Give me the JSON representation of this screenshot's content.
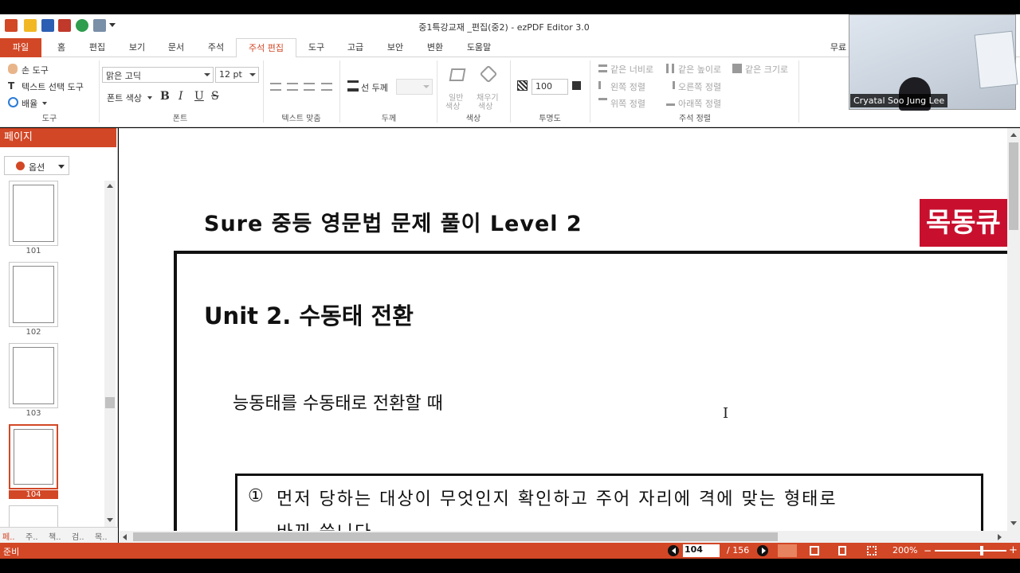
{
  "window": {
    "title": "중1특강교재 _편집(중2) - ezPDF Editor 3.0"
  },
  "tabs": [
    "파일",
    "홈",
    "편집",
    "보기",
    "문서",
    "주석",
    "주석 편집",
    "도구",
    "고급",
    "보안",
    "변환",
    "도움말"
  ],
  "ribbon": {
    "tools": {
      "hand": "손 도구",
      "text_select": "텍스트 선택 도구",
      "zoom": "배율",
      "label": "도구"
    },
    "font": {
      "name": "맑은 고딕",
      "size": "12 pt",
      "color": "폰트 색상",
      "bold": "B",
      "italic": "I",
      "underline": "U",
      "strike": "S",
      "label": "폰트"
    },
    "align": {
      "label": "텍스트 맞춤"
    },
    "line": {
      "thickness": "선 두께",
      "label": "두께"
    },
    "color": {
      "normal": "일반 색상",
      "normal_a": "일반",
      "normal_b": "색상",
      "fill_a": "채우기",
      "fill_b": "색상",
      "label": "색상"
    },
    "opacity": {
      "value": "100",
      "label": "투명도"
    },
    "arrange": {
      "same_width": "같은 너비로",
      "same_height": "같은 높이로",
      "same_size": "같은 크기로",
      "left": "왼쪽 정렬",
      "right": "오른쪽 정렬",
      "top": "위쪽 정렬",
      "bottom": "아래쪽 정렬",
      "label": "주석 정렬"
    },
    "right_text": "무료"
  },
  "video_overlay": {
    "name": "Cryatal Soo Jung Lee"
  },
  "sidebar": {
    "header": "페이지",
    "options": "옵션",
    "pages": [
      "101",
      "102",
      "103",
      "104"
    ],
    "bottom_tabs": [
      "페..",
      "주..",
      "책..",
      "검..",
      "목.."
    ]
  },
  "document": {
    "header": "Sure 중등 영문법 문제 풀이 Level 2",
    "stamp": "목동큐",
    "unit_title": "Unit 2. 수동태 전환",
    "subheading": "능동태를 수동태로 전환할 때",
    "item_number": "①",
    "item_text": "먼저 당하는 대상이 무엇인지 확인하고 주어 자리에 격에 맞는 형태로",
    "item_text_2": "바꿔 씁니다"
  },
  "status": {
    "ready": "준비",
    "current_page": "104",
    "total_pages": "/ 156",
    "zoom": "200%"
  },
  "colors": {
    "accent": "#d24726"
  }
}
